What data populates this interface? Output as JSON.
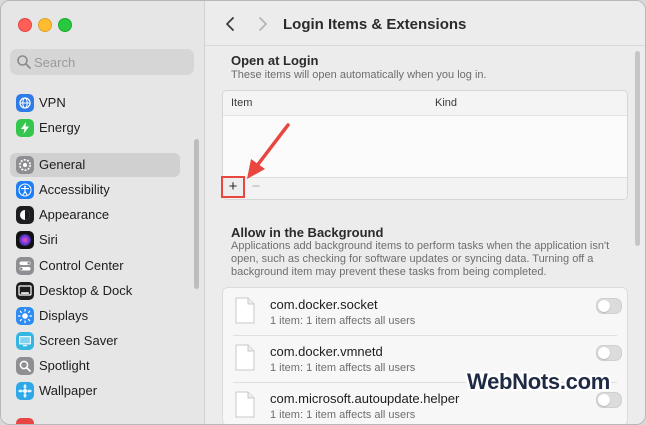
{
  "colors": {
    "accent_red": "#e8463f",
    "sidebar_bg": "#e6e6e6",
    "main_bg": "#ececec"
  },
  "window": {
    "buttons": [
      {
        "name": "close-button",
        "color": "#ff5f57"
      },
      {
        "name": "minimize-button",
        "color": "#febc2e"
      },
      {
        "name": "zoom-button",
        "color": "#28c840"
      }
    ]
  },
  "sidebar": {
    "search": {
      "placeholder": "Search",
      "icon": "magnifier-icon"
    },
    "items": [
      {
        "label": "VPN",
        "icon": "globe-icon",
        "color": "#2f7ce9"
      },
      {
        "label": "Energy",
        "icon": "battery-icon",
        "color": "#35c64f"
      },
      {
        "label": "General",
        "icon": "gear-icon",
        "color": "#8e8e93",
        "selected": true
      },
      {
        "label": "Accessibility",
        "icon": "accessibility-icon",
        "color": "#1d7ef5"
      },
      {
        "label": "Appearance",
        "icon": "appearance-icon",
        "color": "#1d1d1f"
      },
      {
        "label": "Siri",
        "icon": "siri-icon",
        "color": "#6a3be8"
      },
      {
        "label": "Control Center",
        "icon": "control-center-icon",
        "color": "#8e8e93"
      },
      {
        "label": "Desktop & Dock",
        "icon": "dock-icon",
        "color": "#1d1d1f"
      },
      {
        "label": "Displays",
        "icon": "sun-icon",
        "color": "#2f8cf0"
      },
      {
        "label": "Screen Saver",
        "icon": "screen-saver-icon",
        "color": "#35b6e0"
      },
      {
        "label": "Spotlight",
        "icon": "spotlight-icon",
        "color": "#8e8e93"
      },
      {
        "label": "Wallpaper",
        "icon": "wallpaper-icon",
        "color": "#2fa8e8"
      }
    ]
  },
  "main": {
    "title": "Login Items & Extensions",
    "back_icon": "chevron-left-icon",
    "forward_icon": "chevron-right-icon",
    "open_at_login": {
      "heading": "Open at Login",
      "subtitle": "These items will open automatically when you log in.",
      "columns": [
        "Item",
        "Kind"
      ],
      "add_label": "+",
      "remove_label": "−"
    },
    "background": {
      "heading": "Allow in the Background",
      "description": "Applications add background items to perform tasks when the application isn't open, such as checking for software updates or syncing data. Turning off a background item may prevent these tasks from being completed.",
      "description_lines": [
        "Applications add background items to perform tasks when the application isn't",
        "open, such as checking for software updates or syncing data. Turning off a",
        "background item may prevent these tasks from being completed."
      ],
      "items": [
        {
          "name": "com.docker.socket",
          "detail": "1 item: 1 item affects all users",
          "enabled": false
        },
        {
          "name": "com.docker.vmnetd",
          "detail": "1 item: 1 item affects all users",
          "enabled": false
        },
        {
          "name": "com.microsoft.autoupdate.helper",
          "detail": "1 item: 1 item affects all users",
          "enabled": false
        }
      ]
    }
  },
  "watermark": "WebNots.com"
}
